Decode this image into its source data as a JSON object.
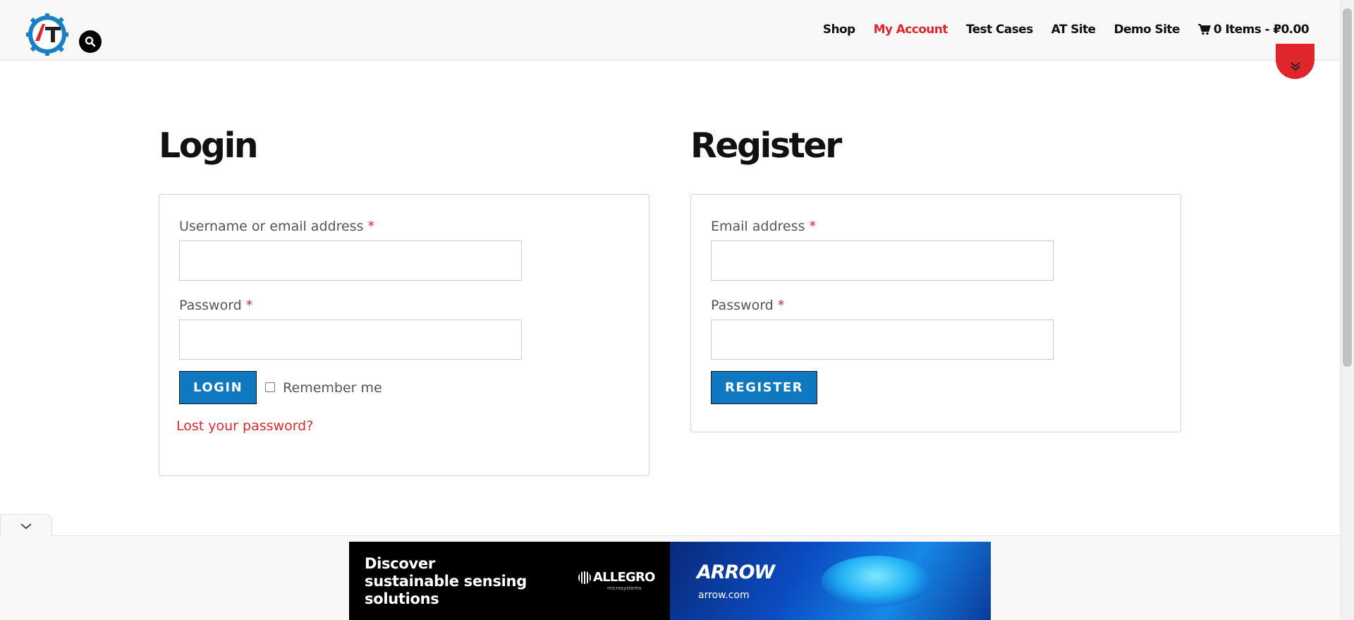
{
  "header": {
    "logo_alt": "AT",
    "nav": {
      "shop": "Shop",
      "my_account": "My Account",
      "test_cases": "Test Cases",
      "at_site": "AT Site",
      "demo_site": "Demo Site",
      "cart": "0 Items - ₽0.00"
    },
    "active_color": "#e0262c"
  },
  "login": {
    "title": "Login",
    "username_label": "Username or email address",
    "password_label": "Password",
    "required_mark": "*",
    "button": "LOGIN",
    "remember": "Remember me",
    "lost_password": "Lost your password?"
  },
  "register": {
    "title": "Register",
    "email_label": "Email address",
    "password_label": "Password",
    "required_mark": "*",
    "button": "REGISTER"
  },
  "ad": {
    "headline_1": "Discover",
    "headline_2": "sustainable sensing",
    "headline_3": "solutions",
    "sponsor": "ALLEGRO",
    "sponsor_sub": "microsystems",
    "brand": "ARROW",
    "brand_url": "arrow.com"
  },
  "colors": {
    "primary_button": "#0e79c1",
    "accent_red": "#e0262c"
  }
}
